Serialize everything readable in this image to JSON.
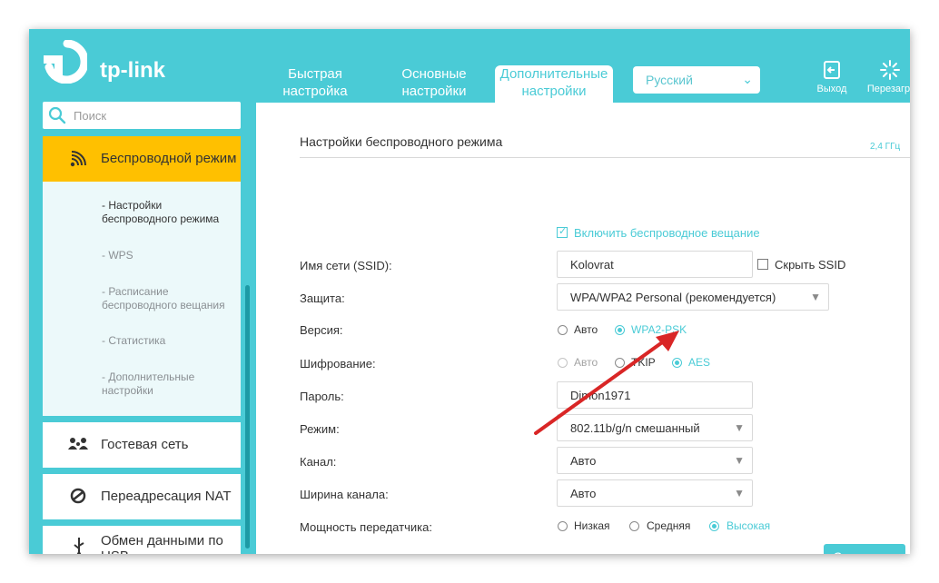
{
  "header": {
    "logo_text": "tp-link",
    "tabs": [
      {
        "label": "Быстрая настройка"
      },
      {
        "label": "Основные настройки"
      },
      {
        "label": "Дополнительные настройки"
      }
    ],
    "language": "Русский",
    "logout_label": "Выход",
    "reboot_label": "Перезагр."
  },
  "sidebar": {
    "search_placeholder": "Поиск",
    "active_item": "Беспроводной режим",
    "subitems": [
      "- Настройки беспроводного режима",
      "- WPS",
      "- Расписание беспроводного вещания",
      "- Статистика",
      "- Дополнительные настройки"
    ],
    "items": [
      {
        "label": "Гостевая сеть",
        "icon": "guest-network-icon"
      },
      {
        "label": "Переадресация NAT",
        "icon": "nat-forwarding-icon"
      },
      {
        "label": "Обмен данными по USB",
        "icon": "usb-icon"
      }
    ]
  },
  "content": {
    "title": "Настройки беспроводного режима",
    "band": "2,4 ГГц",
    "enable_broadcast": "Включить беспроводное вещание",
    "ssid_label": "Имя сети (SSID):",
    "ssid_value": "Kolovrat",
    "hide_ssid": "Скрыть SSID",
    "security_label": "Защита:",
    "security_value": "WPA/WPA2 Personal (рекомендуется)",
    "version_label": "Версия:",
    "version_options": [
      "Авто",
      "WPA2-PSK"
    ],
    "encryption_label": "Шифрование:",
    "encryption_options": [
      "Авто",
      "TKIP",
      "AES"
    ],
    "password_label": "Пароль:",
    "password_value": "Dimon1971",
    "mode_label": "Режим:",
    "mode_value": "802.11b/g/n смешанный",
    "channel_label": "Канал:",
    "channel_value": "Авто",
    "width_label": "Ширина канала:",
    "width_value": "Авто",
    "power_label": "Мощность передатчика:",
    "power_options": [
      "Низкая",
      "Средняя",
      "Высокая"
    ],
    "save_label": "Сохранить"
  },
  "colors": {
    "accent": "#4acbd6",
    "active_item": "#ffc000",
    "arrow": "#d92626"
  }
}
